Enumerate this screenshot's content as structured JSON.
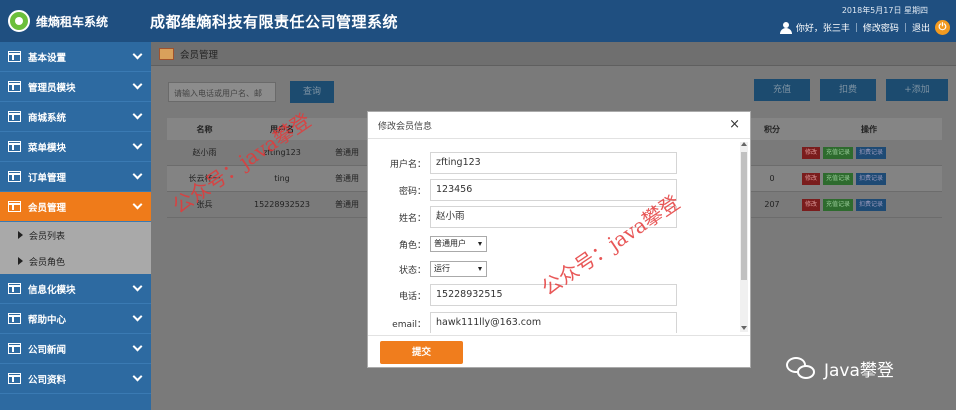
{
  "header": {
    "logo_text": "维熵租车系统",
    "title": "成都维熵科技有限责任公司管理系统",
    "date": "2018年5月17日 星期四",
    "greeting": "你好，张三丰",
    "change_password": "修改密码",
    "logout": "退出"
  },
  "sidebar": {
    "items": [
      {
        "label": "基本设置"
      },
      {
        "label": "管理员模块"
      },
      {
        "label": "商城系统"
      },
      {
        "label": "菜单模块"
      },
      {
        "label": "订单管理"
      },
      {
        "label": "会员管理"
      },
      {
        "label": "信息化模块"
      },
      {
        "label": "帮助中心"
      },
      {
        "label": "公司新闻"
      },
      {
        "label": "公司资料"
      }
    ],
    "sub_items": [
      {
        "label": "会员列表"
      },
      {
        "label": "会员角色"
      }
    ]
  },
  "main": {
    "breadcrumb": "会员管理",
    "search_placeholder": "请输入电话或用户名、邮",
    "search_button": "查询",
    "toolbar": {
      "recharge": "充值",
      "deduct": "扣费",
      "add": "+添加"
    },
    "table": {
      "headers": {
        "name": "名称",
        "username": "用户名",
        "points": "积分",
        "ops": "操作"
      },
      "rows": [
        {
          "name": "赵小雨",
          "username": "zfting123",
          "role": "普通用",
          "points": "",
          "op1": "修改",
          "op2": "充值记录",
          "op3": "扣费记录"
        },
        {
          "name": "长云杯一",
          "username": "ting",
          "role": "普通用",
          "points": "0",
          "op1": "修改",
          "op2": "充值记录",
          "op3": "扣费记录"
        },
        {
          "name": "张兵",
          "username": "15228932523",
          "role": "普通用",
          "points": "207",
          "op1": "修改",
          "op2": "充值记录",
          "op3": "扣费记录"
        }
      ]
    }
  },
  "modal": {
    "title": "修改会员信息",
    "close": "×",
    "fields": {
      "username": {
        "label": "用户名：",
        "value": "zfting123"
      },
      "password": {
        "label": "密码：",
        "value": "123456"
      },
      "name": {
        "label": "姓名：",
        "value": "赵小雨"
      },
      "role": {
        "label": "角色：",
        "value": "普通用户"
      },
      "status": {
        "label": "状态：",
        "value": "运行"
      },
      "phone": {
        "label": "电话：",
        "value": "15228932515"
      },
      "email": {
        "label": "email：",
        "value": "hawk111lly@163.com"
      }
    },
    "submit": "提交"
  },
  "watermarks": {
    "text1": "公众号：java攀登",
    "text2": "公众号：java攀登"
  },
  "wechat_badge": {
    "icon": "wechat-icon",
    "text": "Java攀登"
  },
  "colors": {
    "header": "#1f4f80",
    "sidebar": "#2d6aa1",
    "active": "#ef7b1a",
    "submit": "#f07d1d"
  }
}
